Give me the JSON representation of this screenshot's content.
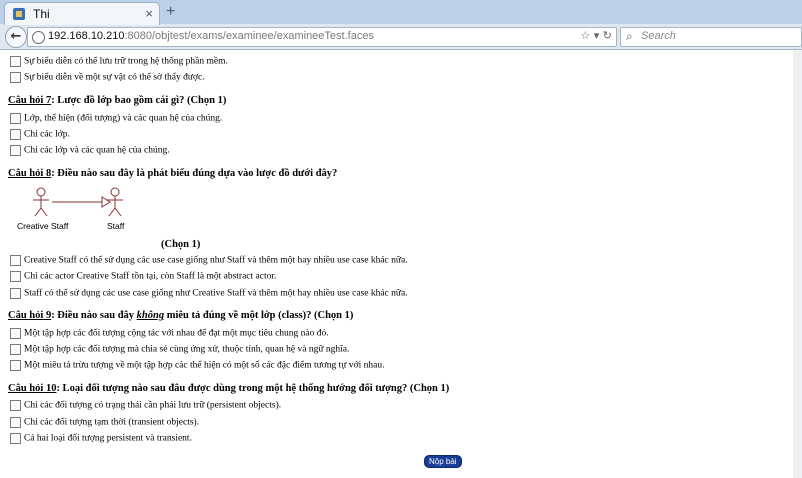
{
  "browser": {
    "tab_title": "Thi",
    "tab_close": "×",
    "new_tab": "+",
    "back": "←",
    "url_host": "192.168.10.210",
    "url_path": ":8080/objtest/exams/examinee/examineeTest.faces",
    "url_tools": "☆ ▾ ↻",
    "search_placeholder": "Search"
  },
  "top_options": [
    "Sự biểu diễn có thể lưu trữ trong hệ thống phần mềm.",
    "Sự biểu diễn về một sự vật có thể sờ thấy được."
  ],
  "q7": {
    "label": "Câu hỏi",
    "number": "7",
    "text": ": Lược đồ lớp bao gồm cái gì? (Chọn 1)",
    "options": [
      "Lớp, thể hiện (đối tượng) và các quan hệ của chúng.",
      "Chỉ các lớp.",
      "Chỉ các lớp và các quan hệ của chúng."
    ]
  },
  "q8": {
    "label": "Câu hỏi",
    "number": "8",
    "text": ": Điều nào sau đây là phát biểu đúng dựa vào lược đồ dưới đây?",
    "diagram": {
      "actor_left": "Creative Staff",
      "actor_right": "Staff"
    },
    "chon": "(Chọn 1)",
    "options": [
      "Creative Staff có thể sử dụng các use case giống như Staff và thêm một hay nhiều use case khác nữa.",
      "Chỉ các actor Creative Staff tồn tại, còn Staff là một abstract actor.",
      "Staff có thể sử dụng các use case giống như Creative Staff và thêm một hay nhiều use case khác nữa."
    ]
  },
  "q9": {
    "label": "Câu hỏi",
    "number": "9",
    "text_a": ": Điều nào sau đây ",
    "text_em": "không",
    "text_b": " miêu tả đúng về một lớp (class)? (Chọn 1)",
    "options": [
      "Một tập hợp các đối tượng cộng tác với nhau để đạt một mục tiêu chung nào đó.",
      "Một tập hợp các đối tượng mà chia sẻ cùng ứng xử, thuộc tính, quan hệ và ngữ nghĩa.",
      "Một miêu tả trừu tượng về một tập hợp các thể hiện có một số các đặc điểm tương tự với nhau."
    ]
  },
  "q10": {
    "label": "Câu hỏi",
    "number": "10",
    "text": ": Loại đối tượng nào sau đâu được dùng trong một hệ thống hướng đối tượng? (Chọn 1)",
    "options": [
      "Chỉ các đối tượng có trạng thái cần phải lưu trữ (persistent objects).",
      "Chỉ các đối tượng tạm thời (transient objects).",
      "Cả hai loại đối tượng persistent và transient."
    ]
  },
  "submit_label": "Nộp bài"
}
